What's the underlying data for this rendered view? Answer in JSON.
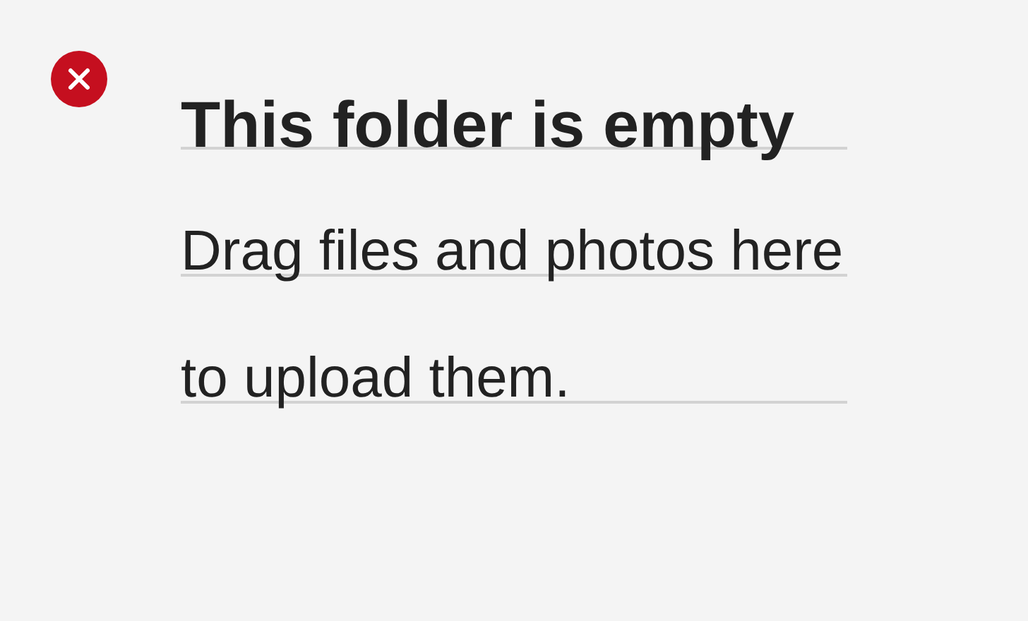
{
  "title": "This folder is empty",
  "message": "Drag files and photos here to upload them."
}
